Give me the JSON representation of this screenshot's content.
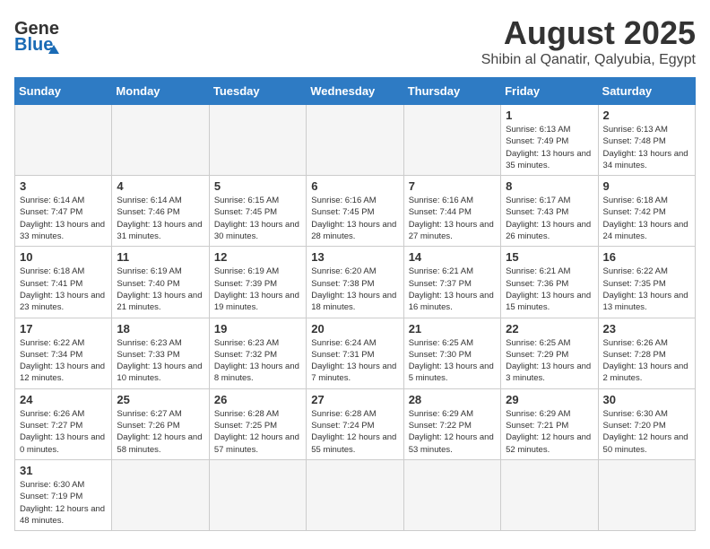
{
  "header": {
    "logo_general": "General",
    "logo_blue": "Blue",
    "title": "August 2025",
    "subtitle": "Shibin al Qanatir, Qalyubia, Egypt"
  },
  "calendar": {
    "days_of_week": [
      "Sunday",
      "Monday",
      "Tuesday",
      "Wednesday",
      "Thursday",
      "Friday",
      "Saturday"
    ],
    "weeks": [
      [
        {
          "day": "",
          "info": ""
        },
        {
          "day": "",
          "info": ""
        },
        {
          "day": "",
          "info": ""
        },
        {
          "day": "",
          "info": ""
        },
        {
          "day": "",
          "info": ""
        },
        {
          "day": "1",
          "info": "Sunrise: 6:13 AM\nSunset: 7:49 PM\nDaylight: 13 hours and 35 minutes."
        },
        {
          "day": "2",
          "info": "Sunrise: 6:13 AM\nSunset: 7:48 PM\nDaylight: 13 hours and 34 minutes."
        }
      ],
      [
        {
          "day": "3",
          "info": "Sunrise: 6:14 AM\nSunset: 7:47 PM\nDaylight: 13 hours and 33 minutes."
        },
        {
          "day": "4",
          "info": "Sunrise: 6:14 AM\nSunset: 7:46 PM\nDaylight: 13 hours and 31 minutes."
        },
        {
          "day": "5",
          "info": "Sunrise: 6:15 AM\nSunset: 7:45 PM\nDaylight: 13 hours and 30 minutes."
        },
        {
          "day": "6",
          "info": "Sunrise: 6:16 AM\nSunset: 7:45 PM\nDaylight: 13 hours and 28 minutes."
        },
        {
          "day": "7",
          "info": "Sunrise: 6:16 AM\nSunset: 7:44 PM\nDaylight: 13 hours and 27 minutes."
        },
        {
          "day": "8",
          "info": "Sunrise: 6:17 AM\nSunset: 7:43 PM\nDaylight: 13 hours and 26 minutes."
        },
        {
          "day": "9",
          "info": "Sunrise: 6:18 AM\nSunset: 7:42 PM\nDaylight: 13 hours and 24 minutes."
        }
      ],
      [
        {
          "day": "10",
          "info": "Sunrise: 6:18 AM\nSunset: 7:41 PM\nDaylight: 13 hours and 23 minutes."
        },
        {
          "day": "11",
          "info": "Sunrise: 6:19 AM\nSunset: 7:40 PM\nDaylight: 13 hours and 21 minutes."
        },
        {
          "day": "12",
          "info": "Sunrise: 6:19 AM\nSunset: 7:39 PM\nDaylight: 13 hours and 19 minutes."
        },
        {
          "day": "13",
          "info": "Sunrise: 6:20 AM\nSunset: 7:38 PM\nDaylight: 13 hours and 18 minutes."
        },
        {
          "day": "14",
          "info": "Sunrise: 6:21 AM\nSunset: 7:37 PM\nDaylight: 13 hours and 16 minutes."
        },
        {
          "day": "15",
          "info": "Sunrise: 6:21 AM\nSunset: 7:36 PM\nDaylight: 13 hours and 15 minutes."
        },
        {
          "day": "16",
          "info": "Sunrise: 6:22 AM\nSunset: 7:35 PM\nDaylight: 13 hours and 13 minutes."
        }
      ],
      [
        {
          "day": "17",
          "info": "Sunrise: 6:22 AM\nSunset: 7:34 PM\nDaylight: 13 hours and 12 minutes."
        },
        {
          "day": "18",
          "info": "Sunrise: 6:23 AM\nSunset: 7:33 PM\nDaylight: 13 hours and 10 minutes."
        },
        {
          "day": "19",
          "info": "Sunrise: 6:23 AM\nSunset: 7:32 PM\nDaylight: 13 hours and 8 minutes."
        },
        {
          "day": "20",
          "info": "Sunrise: 6:24 AM\nSunset: 7:31 PM\nDaylight: 13 hours and 7 minutes."
        },
        {
          "day": "21",
          "info": "Sunrise: 6:25 AM\nSunset: 7:30 PM\nDaylight: 13 hours and 5 minutes."
        },
        {
          "day": "22",
          "info": "Sunrise: 6:25 AM\nSunset: 7:29 PM\nDaylight: 13 hours and 3 minutes."
        },
        {
          "day": "23",
          "info": "Sunrise: 6:26 AM\nSunset: 7:28 PM\nDaylight: 13 hours and 2 minutes."
        }
      ],
      [
        {
          "day": "24",
          "info": "Sunrise: 6:26 AM\nSunset: 7:27 PM\nDaylight: 13 hours and 0 minutes."
        },
        {
          "day": "25",
          "info": "Sunrise: 6:27 AM\nSunset: 7:26 PM\nDaylight: 12 hours and 58 minutes."
        },
        {
          "day": "26",
          "info": "Sunrise: 6:28 AM\nSunset: 7:25 PM\nDaylight: 12 hours and 57 minutes."
        },
        {
          "day": "27",
          "info": "Sunrise: 6:28 AM\nSunset: 7:24 PM\nDaylight: 12 hours and 55 minutes."
        },
        {
          "day": "28",
          "info": "Sunrise: 6:29 AM\nSunset: 7:22 PM\nDaylight: 12 hours and 53 minutes."
        },
        {
          "day": "29",
          "info": "Sunrise: 6:29 AM\nSunset: 7:21 PM\nDaylight: 12 hours and 52 minutes."
        },
        {
          "day": "30",
          "info": "Sunrise: 6:30 AM\nSunset: 7:20 PM\nDaylight: 12 hours and 50 minutes."
        }
      ],
      [
        {
          "day": "31",
          "info": "Sunrise: 6:30 AM\nSunset: 7:19 PM\nDaylight: 12 hours and 48 minutes."
        },
        {
          "day": "",
          "info": ""
        },
        {
          "day": "",
          "info": ""
        },
        {
          "day": "",
          "info": ""
        },
        {
          "day": "",
          "info": ""
        },
        {
          "day": "",
          "info": ""
        },
        {
          "day": "",
          "info": ""
        }
      ]
    ]
  }
}
